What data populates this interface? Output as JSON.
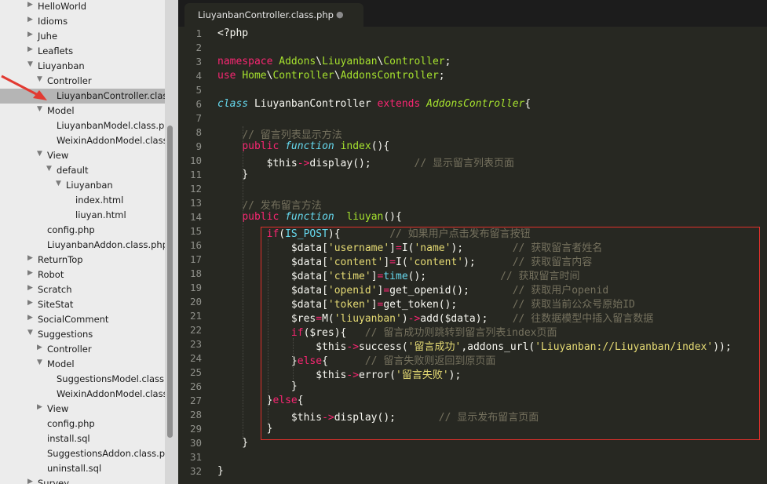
{
  "sidebar": {
    "rows": [
      {
        "name": "HelloWorld",
        "arrow": "▶"
      },
      {
        "name": "Idioms",
        "arrow": "▶"
      },
      {
        "name": "Juhe",
        "arrow": "▶"
      },
      {
        "name": "Leaflets",
        "arrow": "▶"
      },
      {
        "name": "Liuyanban",
        "arrow": "▼"
      },
      {
        "name": "Controller",
        "arrow": "▼"
      },
      {
        "name": "LiuyanbanController.class.php",
        "arrow": ""
      },
      {
        "name": "Model",
        "arrow": "▼"
      },
      {
        "name": "LiuyanbanModel.class.php",
        "arrow": ""
      },
      {
        "name": "WeixinAddonModel.class.php",
        "arrow": ""
      },
      {
        "name": "View",
        "arrow": "▼"
      },
      {
        "name": "default",
        "arrow": "▼"
      },
      {
        "name": "Liuyanban",
        "arrow": "▼"
      },
      {
        "name": "index.html",
        "arrow": ""
      },
      {
        "name": "liuyan.html",
        "arrow": ""
      },
      {
        "name": "config.php",
        "arrow": ""
      },
      {
        "name": "LiuyanbanAddon.class.php",
        "arrow": ""
      },
      {
        "name": "ReturnTop",
        "arrow": "▶"
      },
      {
        "name": "Robot",
        "arrow": "▶"
      },
      {
        "name": "Scratch",
        "arrow": "▶"
      },
      {
        "name": "SiteStat",
        "arrow": "▶"
      },
      {
        "name": "SocialComment",
        "arrow": "▶"
      },
      {
        "name": "Suggestions",
        "arrow": "▼"
      },
      {
        "name": "Controller",
        "arrow": "▶"
      },
      {
        "name": "Model",
        "arrow": "▼"
      },
      {
        "name": "SuggestionsModel.class.php",
        "arrow": ""
      },
      {
        "name": "WeixinAddonModel.class.php",
        "arrow": ""
      },
      {
        "name": "View",
        "arrow": "▶"
      },
      {
        "name": "config.php",
        "arrow": ""
      },
      {
        "name": "install.sql",
        "arrow": ""
      },
      {
        "name": "SuggestionsAddon.class.php",
        "arrow": ""
      },
      {
        "name": "uninstall.sql",
        "arrow": ""
      },
      {
        "name": "Survey",
        "arrow": "▶"
      }
    ]
  },
  "tab": {
    "title": "LiuyanbanController.class.php",
    "dot": "●"
  },
  "colors": {
    "keyword": "#f92672",
    "storage": "#66d9ef",
    "class": "#a6e22e",
    "string": "#e6db74",
    "comment": "#75715e",
    "highlight_border": "#e0302b",
    "annotation_arrow": "#e23a32"
  },
  "code": {
    "line_numbers": [
      "1",
      "2",
      "3",
      "4",
      "5",
      "6",
      "7",
      "8",
      "9",
      "10",
      "11",
      "12",
      "13",
      "14",
      "15",
      "16",
      "17",
      "18",
      "19",
      "20",
      "21",
      "22",
      "23",
      "24",
      "25",
      "26",
      "27",
      "28",
      "29",
      "30",
      "31",
      "32"
    ],
    "tokens": [
      [
        [
          "p",
          "<?php"
        ]
      ],
      [],
      [
        [
          "k",
          "namespace"
        ],
        [
          "p",
          " "
        ],
        [
          "fn",
          "Addons"
        ],
        [
          "p",
          "\\"
        ],
        [
          "fn",
          "Liuyanban"
        ],
        [
          "p",
          "\\"
        ],
        [
          "fn",
          "Controller"
        ],
        [
          "p",
          ";"
        ]
      ],
      [
        [
          "k",
          "use"
        ],
        [
          "p",
          " "
        ],
        [
          "fn",
          "Home"
        ],
        [
          "p",
          "\\"
        ],
        [
          "fn",
          "Controller"
        ],
        [
          "p",
          "\\"
        ],
        [
          "fn",
          "AddonsController"
        ],
        [
          "p",
          ";"
        ]
      ],
      [],
      [
        [
          "st",
          "class"
        ],
        [
          "p",
          " "
        ],
        [
          "p",
          "LiuyanbanController"
        ],
        [
          "p",
          " "
        ],
        [
          "k",
          "extends"
        ],
        [
          "p",
          " "
        ],
        [
          "cls",
          "AddonsController"
        ],
        [
          "p",
          "{"
        ]
      ],
      [],
      [
        [
          "p",
          "    "
        ],
        [
          "c",
          "// 留言列表显示方法"
        ]
      ],
      [
        [
          "p",
          "    "
        ],
        [
          "k",
          "public"
        ],
        [
          "p",
          " "
        ],
        [
          "st",
          "function"
        ],
        [
          "p",
          " "
        ],
        [
          "fn",
          "index"
        ],
        [
          "p",
          "(){"
        ]
      ],
      [
        [
          "p",
          "        "
        ],
        [
          "v",
          "$this"
        ],
        [
          "k",
          "->"
        ],
        [
          "p",
          "display();"
        ],
        [
          "p",
          "       "
        ],
        [
          "c",
          "// 显示留言列表页面"
        ]
      ],
      [
        [
          "p",
          "    }"
        ]
      ],
      [],
      [
        [
          "p",
          "    "
        ],
        [
          "c",
          "// 发布留言方法"
        ]
      ],
      [
        [
          "p",
          "    "
        ],
        [
          "k",
          "public"
        ],
        [
          "p",
          " "
        ],
        [
          "st",
          "function"
        ],
        [
          "p",
          "  "
        ],
        [
          "fn",
          "liuyan"
        ],
        [
          "p",
          "(){"
        ]
      ],
      [
        [
          "p",
          "        "
        ],
        [
          "k",
          "if"
        ],
        [
          "p",
          "("
        ],
        [
          "bi",
          "IS_POST"
        ],
        [
          "p",
          "){"
        ],
        [
          "p",
          "        "
        ],
        [
          "c",
          "// 如果用户点击发布留言按钮"
        ]
      ],
      [
        [
          "p",
          "            "
        ],
        [
          "v",
          "$data"
        ],
        [
          "p",
          "["
        ],
        [
          "s",
          "'username'"
        ],
        [
          "p",
          "]"
        ],
        [
          "k",
          "="
        ],
        [
          "p",
          "I("
        ],
        [
          "s",
          "'name'"
        ],
        [
          "p",
          ");"
        ],
        [
          "p",
          "        "
        ],
        [
          "c",
          "// 获取留言者姓名"
        ]
      ],
      [
        [
          "p",
          "            "
        ],
        [
          "v",
          "$data"
        ],
        [
          "p",
          "["
        ],
        [
          "s",
          "'content'"
        ],
        [
          "p",
          "]"
        ],
        [
          "k",
          "="
        ],
        [
          "p",
          "I("
        ],
        [
          "s",
          "'content'"
        ],
        [
          "p",
          ");"
        ],
        [
          "p",
          "      "
        ],
        [
          "c",
          "// 获取留言内容"
        ]
      ],
      [
        [
          "p",
          "            "
        ],
        [
          "v",
          "$data"
        ],
        [
          "p",
          "["
        ],
        [
          "s",
          "'ctime'"
        ],
        [
          "p",
          "]"
        ],
        [
          "k",
          "="
        ],
        [
          "bi",
          "time"
        ],
        [
          "p",
          "();"
        ],
        [
          "p",
          "            "
        ],
        [
          "c",
          "// 获取留言时间"
        ]
      ],
      [
        [
          "p",
          "            "
        ],
        [
          "v",
          "$data"
        ],
        [
          "p",
          "["
        ],
        [
          "s",
          "'openid'"
        ],
        [
          "p",
          "]"
        ],
        [
          "k",
          "="
        ],
        [
          "p",
          "get_openid();"
        ],
        [
          "p",
          "       "
        ],
        [
          "c",
          "// 获取用户openid"
        ]
      ],
      [
        [
          "p",
          "            "
        ],
        [
          "v",
          "$data"
        ],
        [
          "p",
          "["
        ],
        [
          "s",
          "'token'"
        ],
        [
          "p",
          "]"
        ],
        [
          "k",
          "="
        ],
        [
          "p",
          "get_token();"
        ],
        [
          "p",
          "         "
        ],
        [
          "c",
          "// 获取当前公众号原始ID"
        ]
      ],
      [
        [
          "p",
          "            "
        ],
        [
          "v",
          "$res"
        ],
        [
          "k",
          "="
        ],
        [
          "p",
          "M("
        ],
        [
          "s",
          "'liuyanban'"
        ],
        [
          "p",
          ")"
        ],
        [
          "k",
          "->"
        ],
        [
          "p",
          "add("
        ],
        [
          "v",
          "$data"
        ],
        [
          "p",
          ");"
        ],
        [
          "p",
          "    "
        ],
        [
          "c",
          "// 往数据模型中插入留言数据"
        ]
      ],
      [
        [
          "p",
          "            "
        ],
        [
          "k",
          "if"
        ],
        [
          "p",
          "("
        ],
        [
          "v",
          "$res"
        ],
        [
          "p",
          "){"
        ],
        [
          "p",
          "   "
        ],
        [
          "c",
          "// 留言成功则跳转到留言列表index页面"
        ]
      ],
      [
        [
          "p",
          "                "
        ],
        [
          "v",
          "$this"
        ],
        [
          "k",
          "->"
        ],
        [
          "p",
          "success("
        ],
        [
          "s",
          "'留言成功'"
        ],
        [
          "p",
          ",addons_url("
        ],
        [
          "s",
          "'Liuyanban://Liuyanban/index'"
        ],
        [
          "p",
          "));"
        ]
      ],
      [
        [
          "p",
          "            }"
        ],
        [
          "k",
          "else"
        ],
        [
          "p",
          "{"
        ],
        [
          "p",
          "      "
        ],
        [
          "c",
          "// 留言失败则返回到原页面"
        ]
      ],
      [
        [
          "p",
          "                "
        ],
        [
          "v",
          "$this"
        ],
        [
          "k",
          "->"
        ],
        [
          "p",
          "error("
        ],
        [
          "s",
          "'留言失败'"
        ],
        [
          "p",
          ");"
        ]
      ],
      [
        [
          "p",
          "            }"
        ]
      ],
      [
        [
          "p",
          "        }"
        ],
        [
          "k",
          "else"
        ],
        [
          "p",
          "{"
        ]
      ],
      [
        [
          "p",
          "            "
        ],
        [
          "v",
          "$this"
        ],
        [
          "k",
          "->"
        ],
        [
          "p",
          "display();"
        ],
        [
          "p",
          "       "
        ],
        [
          "c",
          "// 显示发布留言页面"
        ]
      ],
      [
        [
          "p",
          "        }"
        ]
      ],
      [
        [
          "p",
          "    }"
        ]
      ],
      [],
      [
        [
          "p",
          "}"
        ]
      ]
    ]
  }
}
